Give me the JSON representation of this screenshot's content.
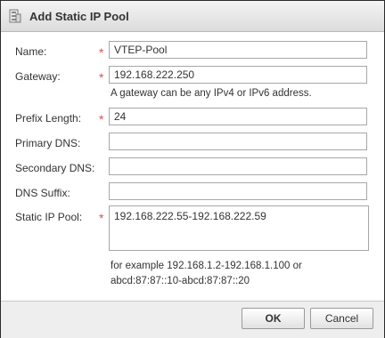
{
  "dialog": {
    "title": "Add Static IP Pool",
    "icon": "ip-pool-icon"
  },
  "fields": {
    "name": {
      "label": "Name:",
      "value": "VTEP-Pool",
      "required": true
    },
    "gateway": {
      "label": "Gateway:",
      "value": "192.168.222.250",
      "required": true,
      "hint": "A gateway can be any IPv4 or IPv6 address."
    },
    "prefix_length": {
      "label": "Prefix Length:",
      "value": "24",
      "required": true
    },
    "primary_dns": {
      "label": "Primary DNS:",
      "value": ""
    },
    "secondary_dns": {
      "label": "Secondary DNS:",
      "value": ""
    },
    "dns_suffix": {
      "label": "DNS Suffix:",
      "value": ""
    },
    "static_ip_pool": {
      "label": "Static IP Pool:",
      "value": "192.168.222.55-192.168.222.59",
      "required": true,
      "example_line1": "for example 192.168.1.2-192.168.1.100 or",
      "example_line2": "abcd:87:87::10-abcd:87:87::20"
    }
  },
  "required_marker": "*",
  "buttons": {
    "ok": "OK",
    "cancel": "Cancel"
  },
  "colors": {
    "required": "#d9534f",
    "border": "#a7a7a7"
  }
}
